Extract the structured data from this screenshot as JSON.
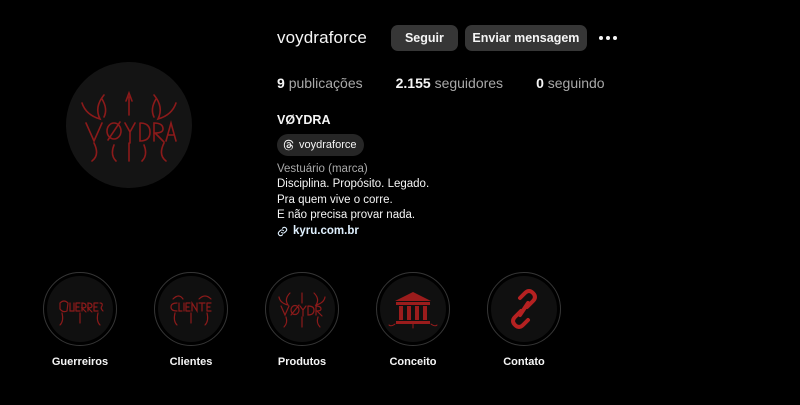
{
  "profile": {
    "username": "voydraforce",
    "follow_label": "Seguir",
    "message_label": "Enviar mensagem",
    "more_icon": "more-horizontal-icon",
    "avatar_icon": "voydra-logo-icon"
  },
  "stats": {
    "posts_count": "9",
    "posts_label": "publicações",
    "followers_count": "2.155",
    "followers_label": "seguidores",
    "following_count": "0",
    "following_label": "seguindo"
  },
  "bio": {
    "full_name": "VØYDRA",
    "threads_handle": "voydraforce",
    "category": "Vestuário (marca)",
    "lines": [
      "Disciplina. Propósito. Legado.",
      "Pra quem vive o corre.",
      "E não precisa provar nada."
    ],
    "link": "kyru.com.br"
  },
  "highlights": [
    {
      "label": "Guerreiros",
      "icon": "guerreiros-logo-icon"
    },
    {
      "label": "Clientes",
      "icon": "clientes-logo-icon"
    },
    {
      "label": "Produtos",
      "icon": "voydra-logo-icon"
    },
    {
      "label": "Conceito",
      "icon": "temple-icon"
    },
    {
      "label": "Contato",
      "icon": "chain-link-icon"
    }
  ],
  "colors": {
    "background": "#000000",
    "button": "#363636",
    "muted_text": "#a8a8a8",
    "accent_red": "#8b1a1a"
  }
}
